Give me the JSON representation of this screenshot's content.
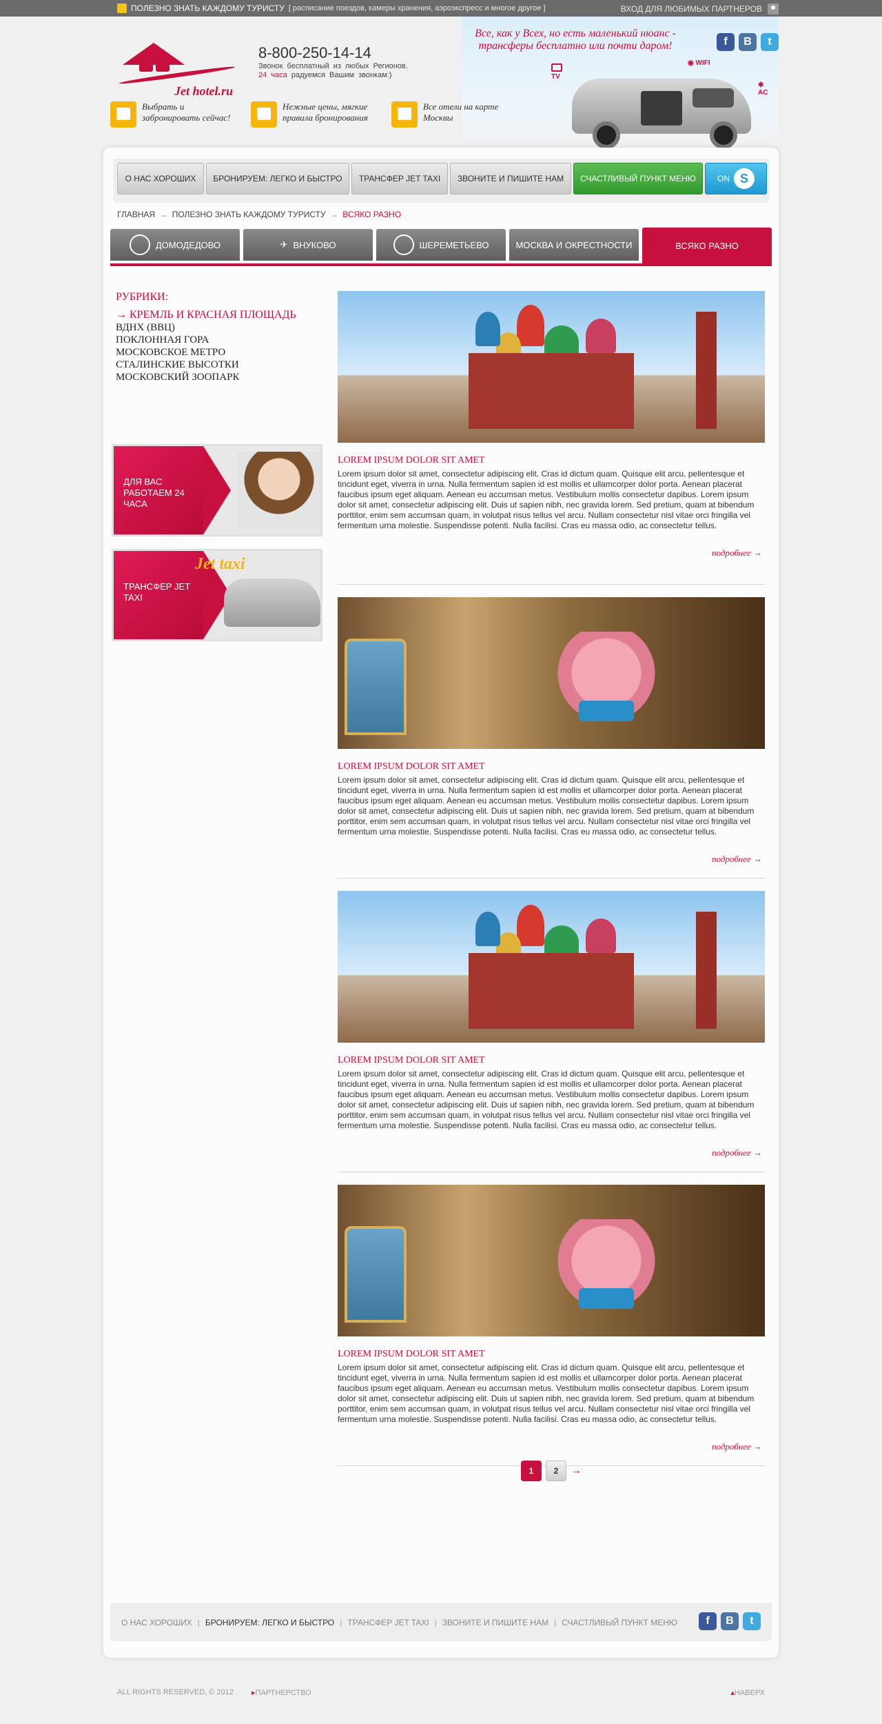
{
  "topbar": {
    "title": "ПОЛЕЗНО ЗНАТЬ КАЖДОМУ ТУРИСТУ",
    "subtitle": "[ расписание поездов, камеры хранения, аэроэкспресс и многое другое ]",
    "partners_login": "ВХОД ДЛЯ ЛЮБИМЫХ ПАРТНЕРОВ"
  },
  "header": {
    "brand": "Jet hotel.ru",
    "phone": "8-800-250-14-14",
    "phone_note_1": "Звонок бесплатный из любых Регионов.",
    "phone_note_hours": "24 часа",
    "phone_note_2": "радуемся Вашим звонкам:)",
    "slogan": "Все, как у Всех, но есть маленький нюанс - трансферы бесплатно или почти даром!",
    "features": [
      "TV",
      "WIFI",
      "AC"
    ],
    "benefits": [
      {
        "text": "Выбрать и забронировать сейчас!"
      },
      {
        "text": "Нежные цены, мягкие правила бронирования"
      },
      {
        "text": "Все отели на карте Москвы"
      }
    ]
  },
  "social": {
    "fb": "f",
    "vk": "B",
    "tw": "t"
  },
  "menu": {
    "items": [
      "О НАС ХОРОШИХ",
      "БРОНИРУЕМ: ЛЕГКО И БЫСТРО",
      "ТРАНСФЕР JET TAXI",
      "ЗВОНИТЕ И ПИШИТЕ НАМ",
      "СЧАСТЛИВЫЙ ПУНКТ МЕНЮ"
    ],
    "skype_label": "ON",
    "skype_logo": "S"
  },
  "breadcrumb": {
    "home": "ГЛАВНАЯ",
    "section": "ПОЛЕЗНО ЗНАТЬ КАЖДОМУ ТУРИСТУ",
    "current": "ВСЯКО РАЗНО"
  },
  "tabs": [
    "ДОМОДЕДОВО",
    "ВНУКОВО",
    "ШЕРЕМЕТЬЕВО",
    "МОСКВА И ОКРЕСТНОСТИ",
    "ВСЯКО РАЗНО"
  ],
  "sidebar": {
    "rubrics_title": "РУБРИКИ:",
    "rubrics": [
      "→ КРЕМЛЬ И КРАСНАЯ ПЛОЩАДЬ",
      "ВДНХ (ВВЦ)",
      "ПОКЛОННАЯ ГОРА",
      "МОСКОВСКОЕ МЕТРО",
      "СТАЛИНСКИЕ ВЫСОТКИ",
      "МОСКОВСКИЙ ЗООПАРК"
    ],
    "banner1": "ДЛЯ ВАС РАБОТАЕМ 24 ЧАСА",
    "banner2": "ТРАНСФЕР JET TAXI",
    "banner2_jet": "Jet taxi"
  },
  "posts": [
    {
      "title": "LOREM IPSUM DOLOR SIT AMET",
      "more": "подробнее →",
      "text": "Lorem ipsum dolor sit amet, consectetur adipiscing elit. Cras id dictum quam. Quisque elit arcu, pellentesque et tincidunt eget, viverra in urna. Nulla fermentum sapien id est mollis et ullamcorper dolor porta. Aenean placerat faucibus ipsum eget aliquam. Aenean eu accumsan metus. Vestibulum mollis consectetur dapibus. Lorem ipsum dolor sit amet, consectetur adipiscing elit. Duis ut sapien nibh, nec gravida lorem. Sed pretium, quam at bibendum porttitor, enim sem accumsan quam, in volutpat risus tellus vel arcu. Nullam consectetur nisl vitae orci fringilla vel fermentum urna molestie. Suspendisse potenti. Nulla facilisi. Cras eu massa odio, ac consectetur tellus."
    },
    {
      "title": "LOREM IPSUM DOLOR SIT AMET",
      "more": "подробнее →",
      "text": "Lorem ipsum dolor sit amet, consectetur adipiscing elit. Cras id dictum quam. Quisque elit arcu, pellentesque et tincidunt eget, viverra in urna. Nulla fermentum sapien id est mollis et ullamcorper dolor porta. Aenean placerat faucibus ipsum eget aliquam. Aenean eu accumsan metus. Vestibulum mollis consectetur dapibus. Lorem ipsum dolor sit amet, consectetur adipiscing elit. Duis ut sapien nibh, nec gravida lorem. Sed pretium, quam at bibendum porttitor, enim sem accumsan quam, in volutpat risus tellus vel arcu. Nullam consectetur nisl vitae orci fringilla vel fermentum urna molestie. Suspendisse potenti. Nulla facilisi. Cras eu massa odio, ac consectetur tellus."
    },
    {
      "title": "LOREM IPSUM DOLOR SIT AMET",
      "more": "подробнее →",
      "text": "Lorem ipsum dolor sit amet, consectetur adipiscing elit. Cras id dictum quam. Quisque elit arcu, pellentesque et tincidunt eget, viverra in urna. Nulla fermentum sapien id est mollis et ullamcorper dolor porta. Aenean placerat faucibus ipsum eget aliquam. Aenean eu accumsan metus. Vestibulum mollis consectetur dapibus. Lorem ipsum dolor sit amet, consectetur adipiscing elit. Duis ut sapien nibh, nec gravida lorem. Sed pretium, quam at bibendum porttitor, enim sem accumsan quam, in volutpat risus tellus vel arcu. Nullam consectetur nisl vitae orci fringilla vel fermentum urna molestie. Suspendisse potenti. Nulla facilisi. Cras eu massa odio, ac consectetur tellus."
    },
    {
      "title": "LOREM IPSUM DOLOR SIT AMET",
      "more": "подробнее →",
      "text": "Lorem ipsum dolor sit amet, consectetur adipiscing elit. Cras id dictum quam. Quisque elit arcu, pellentesque et tincidunt eget, viverra in urna. Nulla fermentum sapien id est mollis et ullamcorper dolor porta. Aenean placerat faucibus ipsum eget aliquam. Aenean eu accumsan metus. Vestibulum mollis consectetur dapibus. Lorem ipsum dolor sit amet, consectetur adipiscing elit. Duis ut sapien nibh, nec gravida lorem. Sed pretium, quam at bibendum porttitor, enim sem accumsan quam, in volutpat risus tellus vel arcu. Nullam consectetur nisl vitae orci fringilla vel fermentum urna molestie. Suspendisse potenti. Nulla facilisi. Cras eu massa odio, ac consectetur tellus."
    }
  ],
  "pager": {
    "pages": [
      "1",
      "2"
    ],
    "next": "→"
  },
  "footer": {
    "links": [
      "О НАС ХОРОШИХ",
      "БРОНИРУЕМ: ЛЕГКО И БЫСТРО",
      "ТРАНСФЕР JET TAXI",
      "ЗВОНИТЕ И ПИШИТЕ НАМ",
      "СЧАСТЛИВЫЙ ПУНКТ МЕНЮ"
    ],
    "copyright": "ALL RIGHTS RESERVED, © 2012",
    "partnership": "ПАРТНЕРСТВО",
    "to_top": "НАВЕРХ"
  },
  "colors": {
    "accent": "#c8103e",
    "menu_green": "#3fa83a",
    "skype_blue": "#2aa7e0",
    "benefit_yellow": "#f5b50a"
  }
}
